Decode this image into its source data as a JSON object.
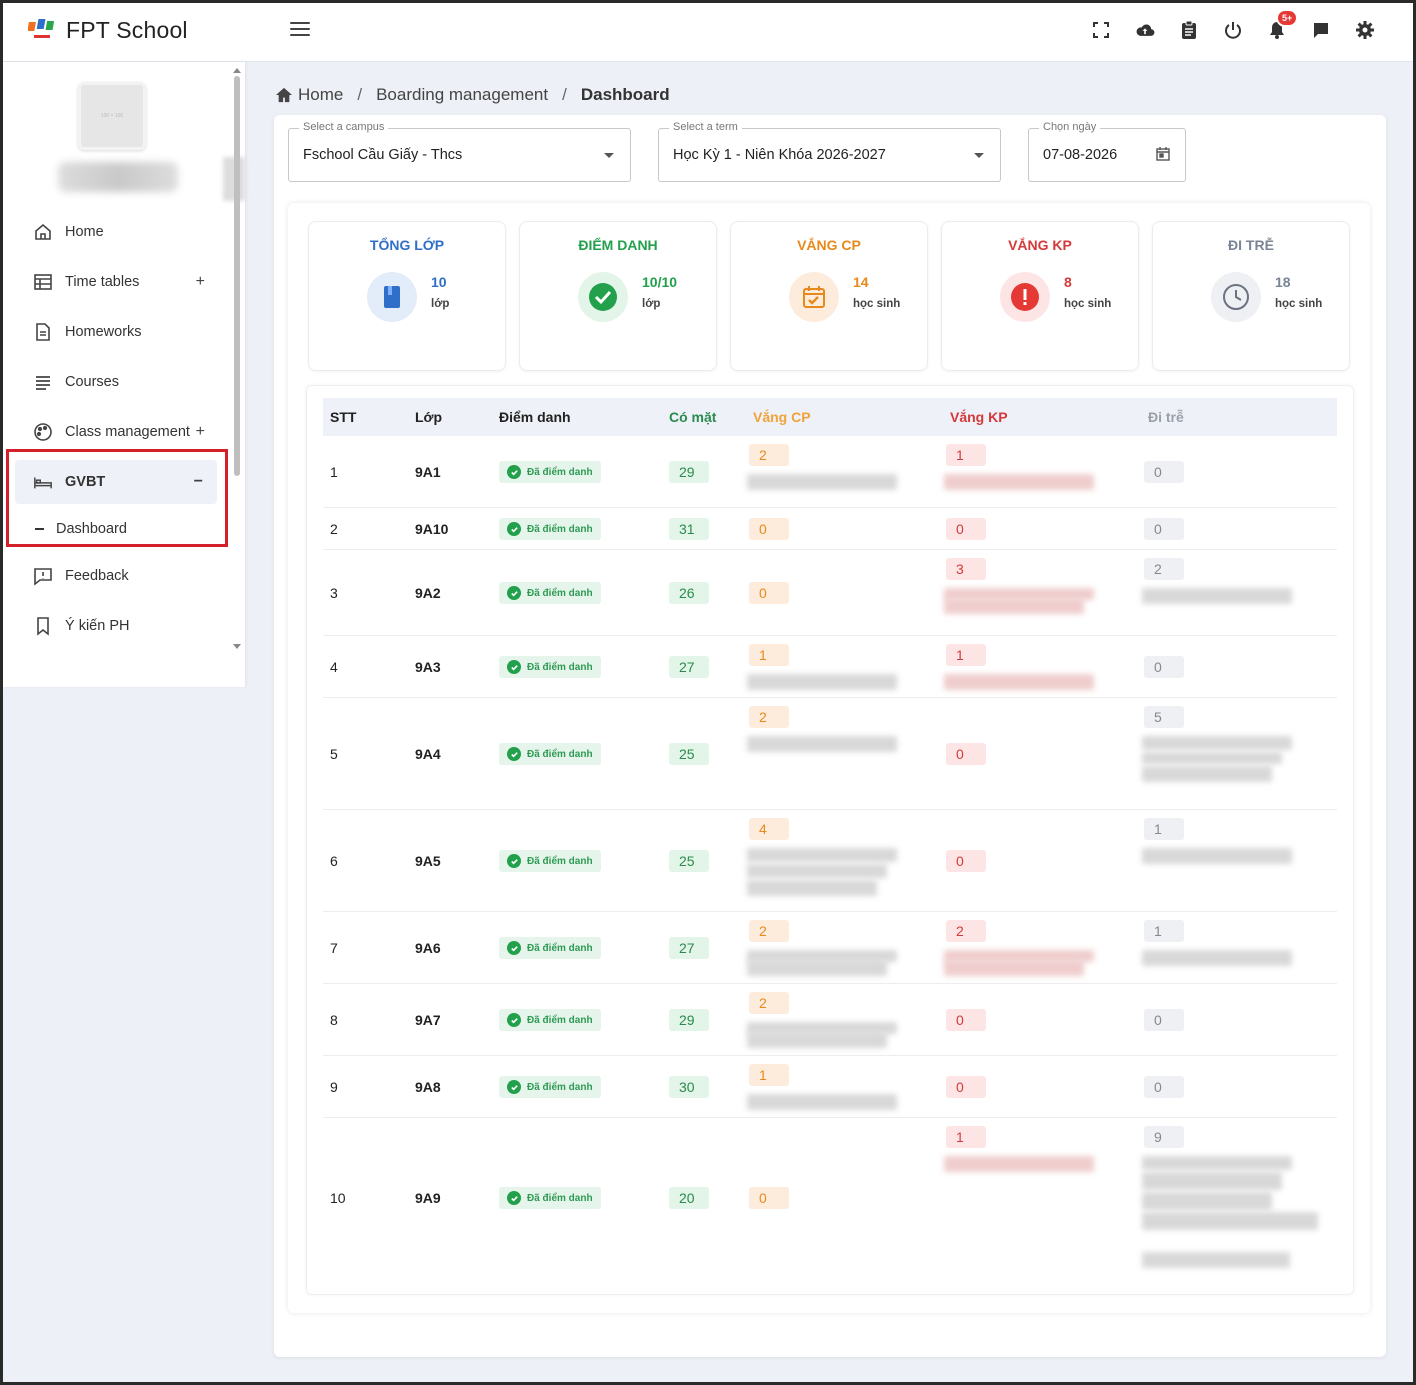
{
  "app": {
    "brand": "FPT School"
  },
  "topbar": {
    "icons": [
      "fullscreen-icon",
      "cloud-upload-icon",
      "clipboard-icon",
      "power-icon",
      "bell-icon",
      "chat-icon",
      "gear-icon"
    ],
    "notification_badge": "5+"
  },
  "sidebar": {
    "avatar_placeholder": "100 × 100",
    "items": [
      {
        "label": "Home",
        "icon": "home-icon"
      },
      {
        "label": "Time tables",
        "icon": "table-icon",
        "expand": "+"
      },
      {
        "label": "Homeworks",
        "icon": "document-icon"
      },
      {
        "label": "Courses",
        "icon": "list-icon"
      },
      {
        "label": "Class management",
        "icon": "palette-icon",
        "expand": "+"
      },
      {
        "label": "GVBT",
        "icon": "bed-icon",
        "expand": "−"
      },
      {
        "label": "Dashboard"
      },
      {
        "label": "Feedback",
        "icon": "feedback-icon"
      },
      {
        "label": "Ý kiến PH",
        "icon": "bookmark-icon"
      }
    ]
  },
  "breadcrumb": {
    "home": "Home",
    "section": "Boarding management",
    "current": "Dashboard"
  },
  "filters": {
    "campus": {
      "label": "Select a campus",
      "value": "Fschool Cầu Giấy - Thcs"
    },
    "term": {
      "label": "Select a term",
      "value": "Học Kỳ 1 - Niên Khóa 2026-2027"
    },
    "date": {
      "label": "Chọn ngày",
      "value": "07-08-2026"
    }
  },
  "stats": [
    {
      "title": "TỔNG LỚP",
      "value": "10",
      "unit": "lớp",
      "color": "#2f6fc9"
    },
    {
      "title": "ĐIỂM DANH",
      "value": "10/10",
      "unit": "lớp",
      "color": "#22a04b"
    },
    {
      "title": "VẮNG CP",
      "value": "14",
      "unit": "học sinh",
      "color": "#e8891c"
    },
    {
      "title": "VẮNG KP",
      "value": "8",
      "unit": "học sinh",
      "color": "#d43a3a"
    },
    {
      "title": "ĐI TRỄ",
      "value": "18",
      "unit": "học sinh",
      "color": "#7b8494"
    }
  ],
  "table": {
    "headers": [
      "STT",
      "Lớp",
      "Điểm danh",
      "Có mặt",
      "Vắng CP",
      "Vắng KP",
      "Đi trễ"
    ],
    "status_label": "Đã điểm danh",
    "rows": [
      {
        "stt": "1",
        "lop": "9A1",
        "co_mat": "29",
        "vang_cp": "2",
        "vang_kp": "1",
        "di_tre": "0"
      },
      {
        "stt": "2",
        "lop": "9A10",
        "co_mat": "31",
        "vang_cp": "0",
        "vang_kp": "0",
        "di_tre": "0"
      },
      {
        "stt": "3",
        "lop": "9A2",
        "co_mat": "26",
        "vang_cp": "0",
        "vang_kp": "3",
        "di_tre": "2"
      },
      {
        "stt": "4",
        "lop": "9A3",
        "co_mat": "27",
        "vang_cp": "1",
        "vang_kp": "1",
        "di_tre": "0"
      },
      {
        "stt": "5",
        "lop": "9A4",
        "co_mat": "25",
        "vang_cp": "2",
        "vang_kp": "0",
        "di_tre": "5"
      },
      {
        "stt": "6",
        "lop": "9A5",
        "co_mat": "25",
        "vang_cp": "4",
        "vang_kp": "0",
        "di_tre": "1"
      },
      {
        "stt": "7",
        "lop": "9A6",
        "co_mat": "27",
        "vang_cp": "2",
        "vang_kp": "2",
        "di_tre": "1"
      },
      {
        "stt": "8",
        "lop": "9A7",
        "co_mat": "29",
        "vang_cp": "2",
        "vang_kp": "0",
        "di_tre": "0"
      },
      {
        "stt": "9",
        "lop": "9A8",
        "co_mat": "30",
        "vang_cp": "1",
        "vang_kp": "0",
        "di_tre": "0"
      },
      {
        "stt": "10",
        "lop": "9A9",
        "co_mat": "20",
        "vang_cp": "0",
        "vang_kp": "1",
        "di_tre": "9"
      }
    ]
  }
}
